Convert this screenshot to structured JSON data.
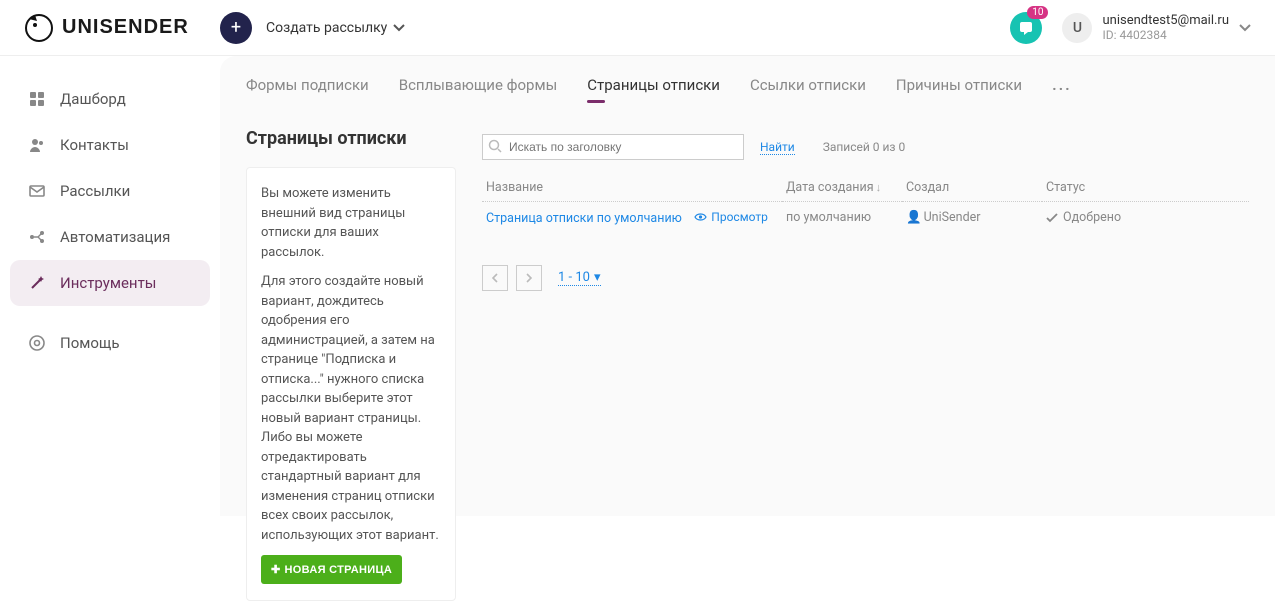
{
  "brand": "UNISENDER",
  "header": {
    "create_label": "Создать рассылку",
    "notif_badge": "10",
    "avatar_letter": "U",
    "user_email": "unisendtest5@mail.ru",
    "user_id": "ID: 4402384"
  },
  "sidebar": {
    "items": [
      {
        "label": "Дашборд"
      },
      {
        "label": "Контакты"
      },
      {
        "label": "Рассылки"
      },
      {
        "label": "Автоматизация"
      },
      {
        "label": "Инструменты"
      },
      {
        "label": "Помощь"
      }
    ]
  },
  "tabs": {
    "items": [
      {
        "label": "Формы подписки"
      },
      {
        "label": "Всплывающие формы"
      },
      {
        "label": "Страницы отписки"
      },
      {
        "label": "Ссылки отписки"
      },
      {
        "label": "Причины отписки"
      }
    ]
  },
  "page": {
    "title": "Страницы отписки"
  },
  "help": {
    "p1": "Вы можете изменить внешний вид страницы отписки для ваших рассылок.",
    "p2": "Для этого создайте новый вариант, дождитесь одобрения его администрацией, а затем на странице \"Подписка и отписка...\" нужного списка рассылки выберите этот новый вариант страницы. Либо вы можете отредактировать стандартный вариант для изменения страниц отписки всех своих рассылок, использующих этот вариант.",
    "button": "НОВАЯ СТРАНИЦА"
  },
  "search": {
    "placeholder": "Искать по заголовку",
    "find": "Найти",
    "count": "Записей 0 из 0"
  },
  "table": {
    "headers": {
      "title": "Название",
      "created": "Дата создания",
      "author": "Создал",
      "status": "Статус"
    },
    "rows": [
      {
        "title": "Страница отписки по умолчанию",
        "preview": "Просмотр",
        "created": "по умолчанию",
        "author": "UniSender",
        "status": "Одобрено"
      }
    ]
  },
  "pager": {
    "range": "1 - 10"
  }
}
